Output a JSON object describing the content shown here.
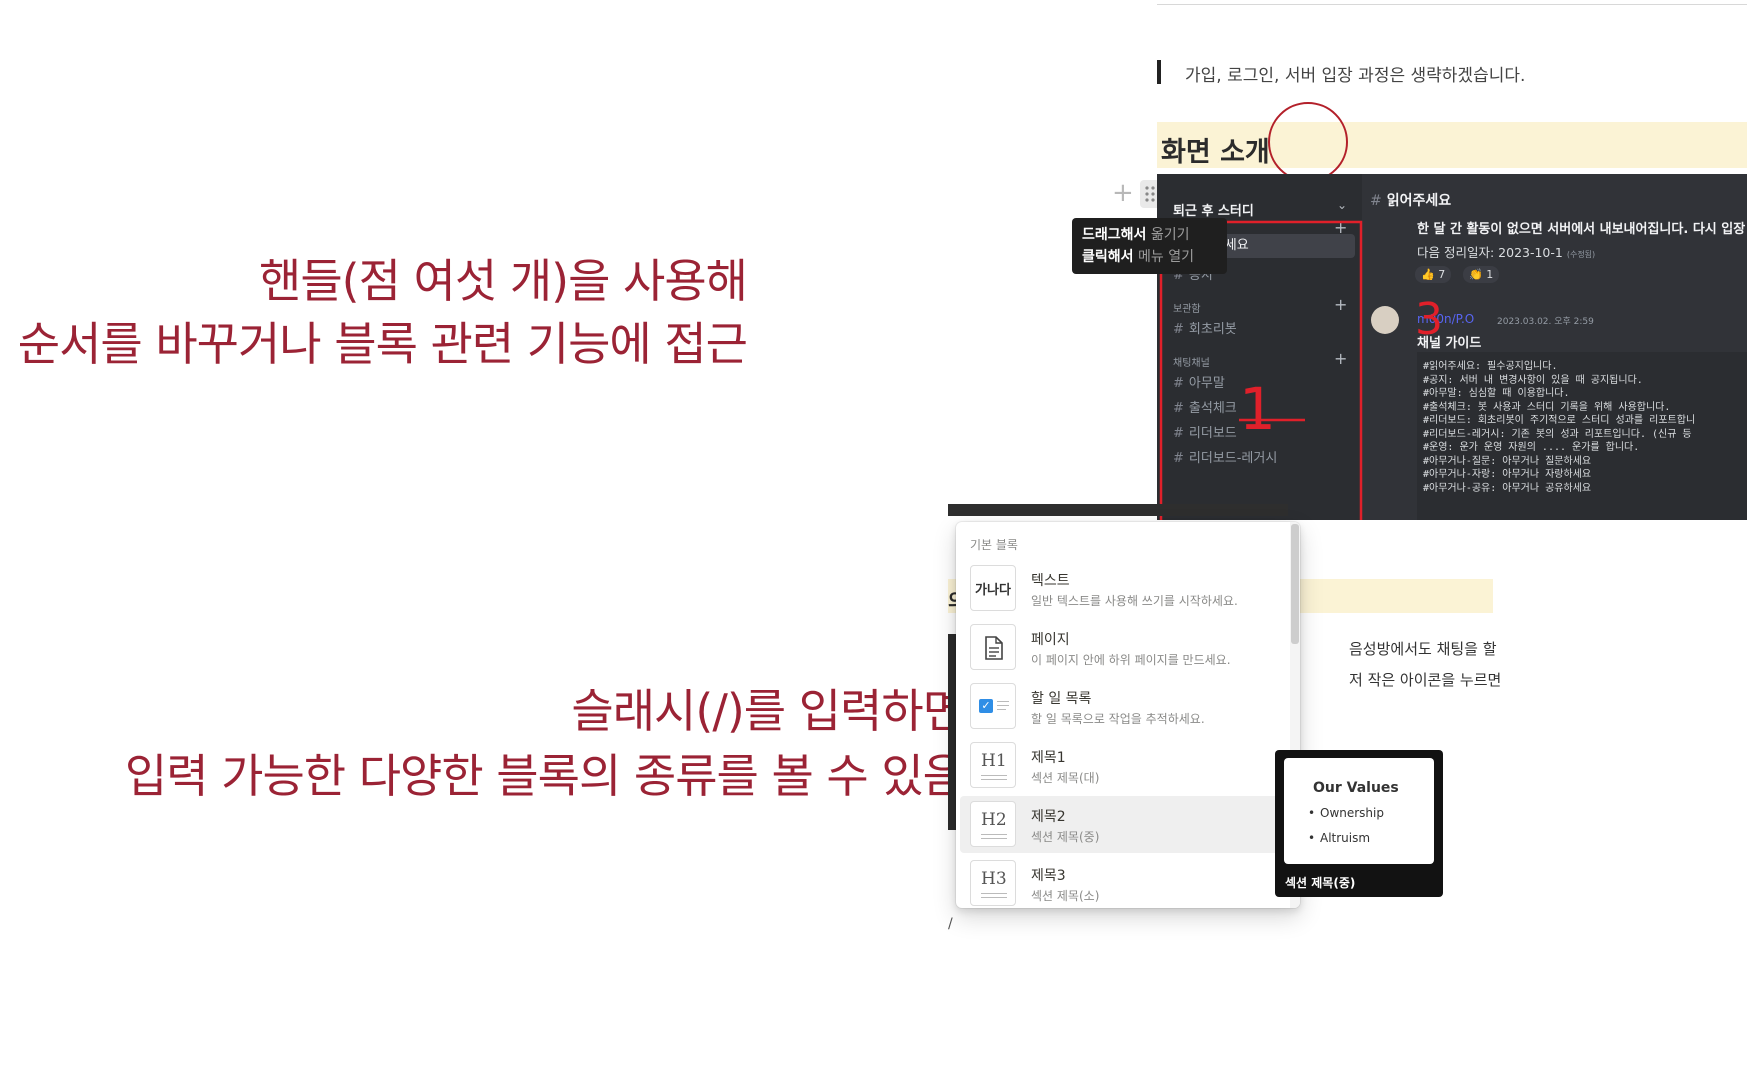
{
  "captions": {
    "handle_line1": "핸들(점 여섯 개)을 사용해",
    "handle_line2": "순서를 바꾸거나 블록 관련 기능에 접근",
    "slash_line1": "슬래시(/)를 입력하면",
    "slash_line2": "입력 가능한 다양한 블록의 종류를 볼 수 있음"
  },
  "top_shot": {
    "quote_text": "가입, 로그인, 서버 입장 과정은 생략하겠습니다.",
    "heading": "화면 소개",
    "plus_glyph": "+",
    "tooltip": {
      "line1_bold": "드래그해서",
      "line1_rest": " 옮기기",
      "line2_bold": "클릭해서",
      "line2_rest": " 메뉴 열기"
    },
    "discord": {
      "server_name": "퇴근 후 스터디",
      "header_channel": "읽어주세요",
      "categories": [
        "보관함",
        "채팅채널"
      ],
      "channels": [
        "읽어주세요",
        "공지",
        "회초리봇",
        "아무말",
        "출석체크",
        "리더보드",
        "리더보드-레거시"
      ],
      "message_bold": "한 달 간 활동이 없으면 서버에서 내보내어집니다. 다시 입장",
      "message_next": "다음 정리일자: 2023-10-1",
      "message_next_note": "(수정됨)",
      "reactions": [
        "👍 7",
        "👏 1"
      ],
      "username": "m00n/P.O",
      "date": "2023.03.02. 오후 2:59",
      "guide_title": "채널 가이드",
      "guide_lines": [
        "#읽어주세요: 필수공지입니다.",
        "#공지: 서버 내 변경사항이 있을 때 공지됩니다.",
        "#아무말: 심심할 때 이용합니다.",
        "#출석체크: 봇 사용과 스터디 기록을 위해 사용합니다.",
        "#리더보드: 회초리봇이 주기적으로 스터디 성과를 리포트합니",
        "#리더보드-레거시: 기존 봇의 성과 리포트입니다. (신규 등",
        "#운영: 운가 운영 자원의 .... 운가를 합니다.",
        "#아무거나-질문: 아무거나 질문하세요",
        "#아무거나-자랑: 아무거나 자랑하세요",
        "#아무거나-공유: 아무거나 공유하세요"
      ],
      "annotations": [
        "1",
        "3"
      ]
    },
    "accent_color": "#b3202a"
  },
  "bottom_shot": {
    "section_label": "기본 블록",
    "items": [
      {
        "title": "텍스트",
        "desc": "일반 텍스트를 사용해 쓰기를 시작하세요.",
        "icon_text": "가나다"
      },
      {
        "title": "페이지",
        "desc": "이 페이지 안에 하위 페이지를 만드세요.",
        "icon": "page-icon"
      },
      {
        "title": "할 일 목록",
        "desc": "할 일 목록으로 작업을 추적하세요.",
        "icon": "todo-checkbox-icon"
      },
      {
        "title": "제목1",
        "desc": "섹션 제목(대)",
        "icon_text": "H1"
      },
      {
        "title": "제목2",
        "desc": "섹션 제목(중)",
        "icon_text": "H2"
      },
      {
        "title": "제목3",
        "desc": "섹션 제목(소)",
        "icon_text": "H3"
      }
    ],
    "bg_text_1": "음성방에서도 채팅을 할",
    "bg_text_2": "저 작은 아이콘을 누르면",
    "bg_partial": "의",
    "slash_char": "/",
    "preview": {
      "title": "Our Values",
      "bullets": [
        "Ownership",
        "Altruism"
      ],
      "caption": "섹션 제목(중)"
    }
  },
  "colors": {
    "caption": "#9b2335",
    "heading_highlight": "#fbf3d5",
    "discord_bg": "#313338"
  }
}
